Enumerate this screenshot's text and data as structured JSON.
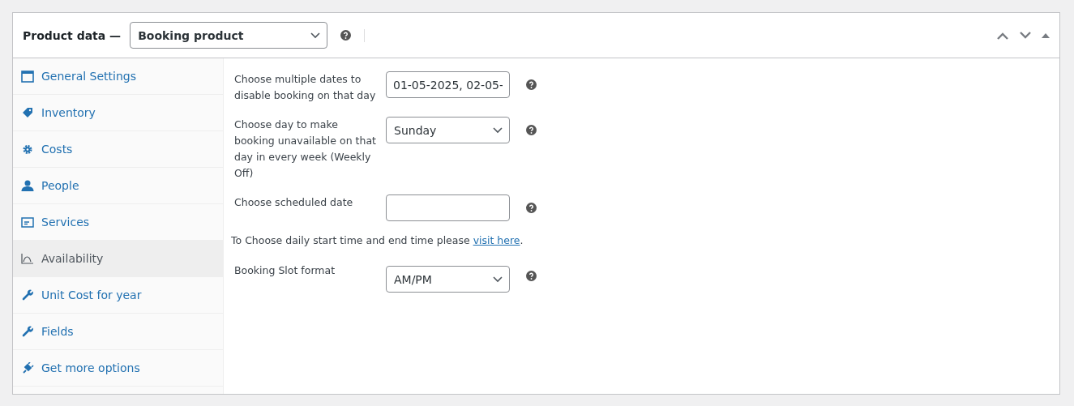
{
  "header": {
    "title": "Product data —",
    "product_type": "Booking product"
  },
  "tabs": [
    {
      "label": "General Settings",
      "selected": false
    },
    {
      "label": "Inventory",
      "selected": false
    },
    {
      "label": "Costs",
      "selected": false
    },
    {
      "label": "People",
      "selected": false
    },
    {
      "label": "Services",
      "selected": false
    },
    {
      "label": "Availability",
      "selected": true
    },
    {
      "label": "Unit Cost for year",
      "selected": false
    },
    {
      "label": "Fields",
      "selected": false
    },
    {
      "label": "Get more options",
      "selected": false
    }
  ],
  "fields_top": [
    {
      "kind": "text",
      "label": "Choose multiple dates to disable booking on that day",
      "value": "01-05-2025, 02-05-"
    },
    {
      "kind": "select",
      "label": "Choose day to make booking unavailable on that day in every week (Weekly Off)",
      "value": "Sunday"
    },
    {
      "kind": "text",
      "label": "Choose scheduled date"
    }
  ],
  "notice": {
    "text": "To Choose daily start time and end time please",
    "link": "visit here",
    "after": "."
  },
  "fields_bottom": [
    {
      "kind": "select",
      "label": "Booking Slot format",
      "value": "AM/PM"
    }
  ]
}
